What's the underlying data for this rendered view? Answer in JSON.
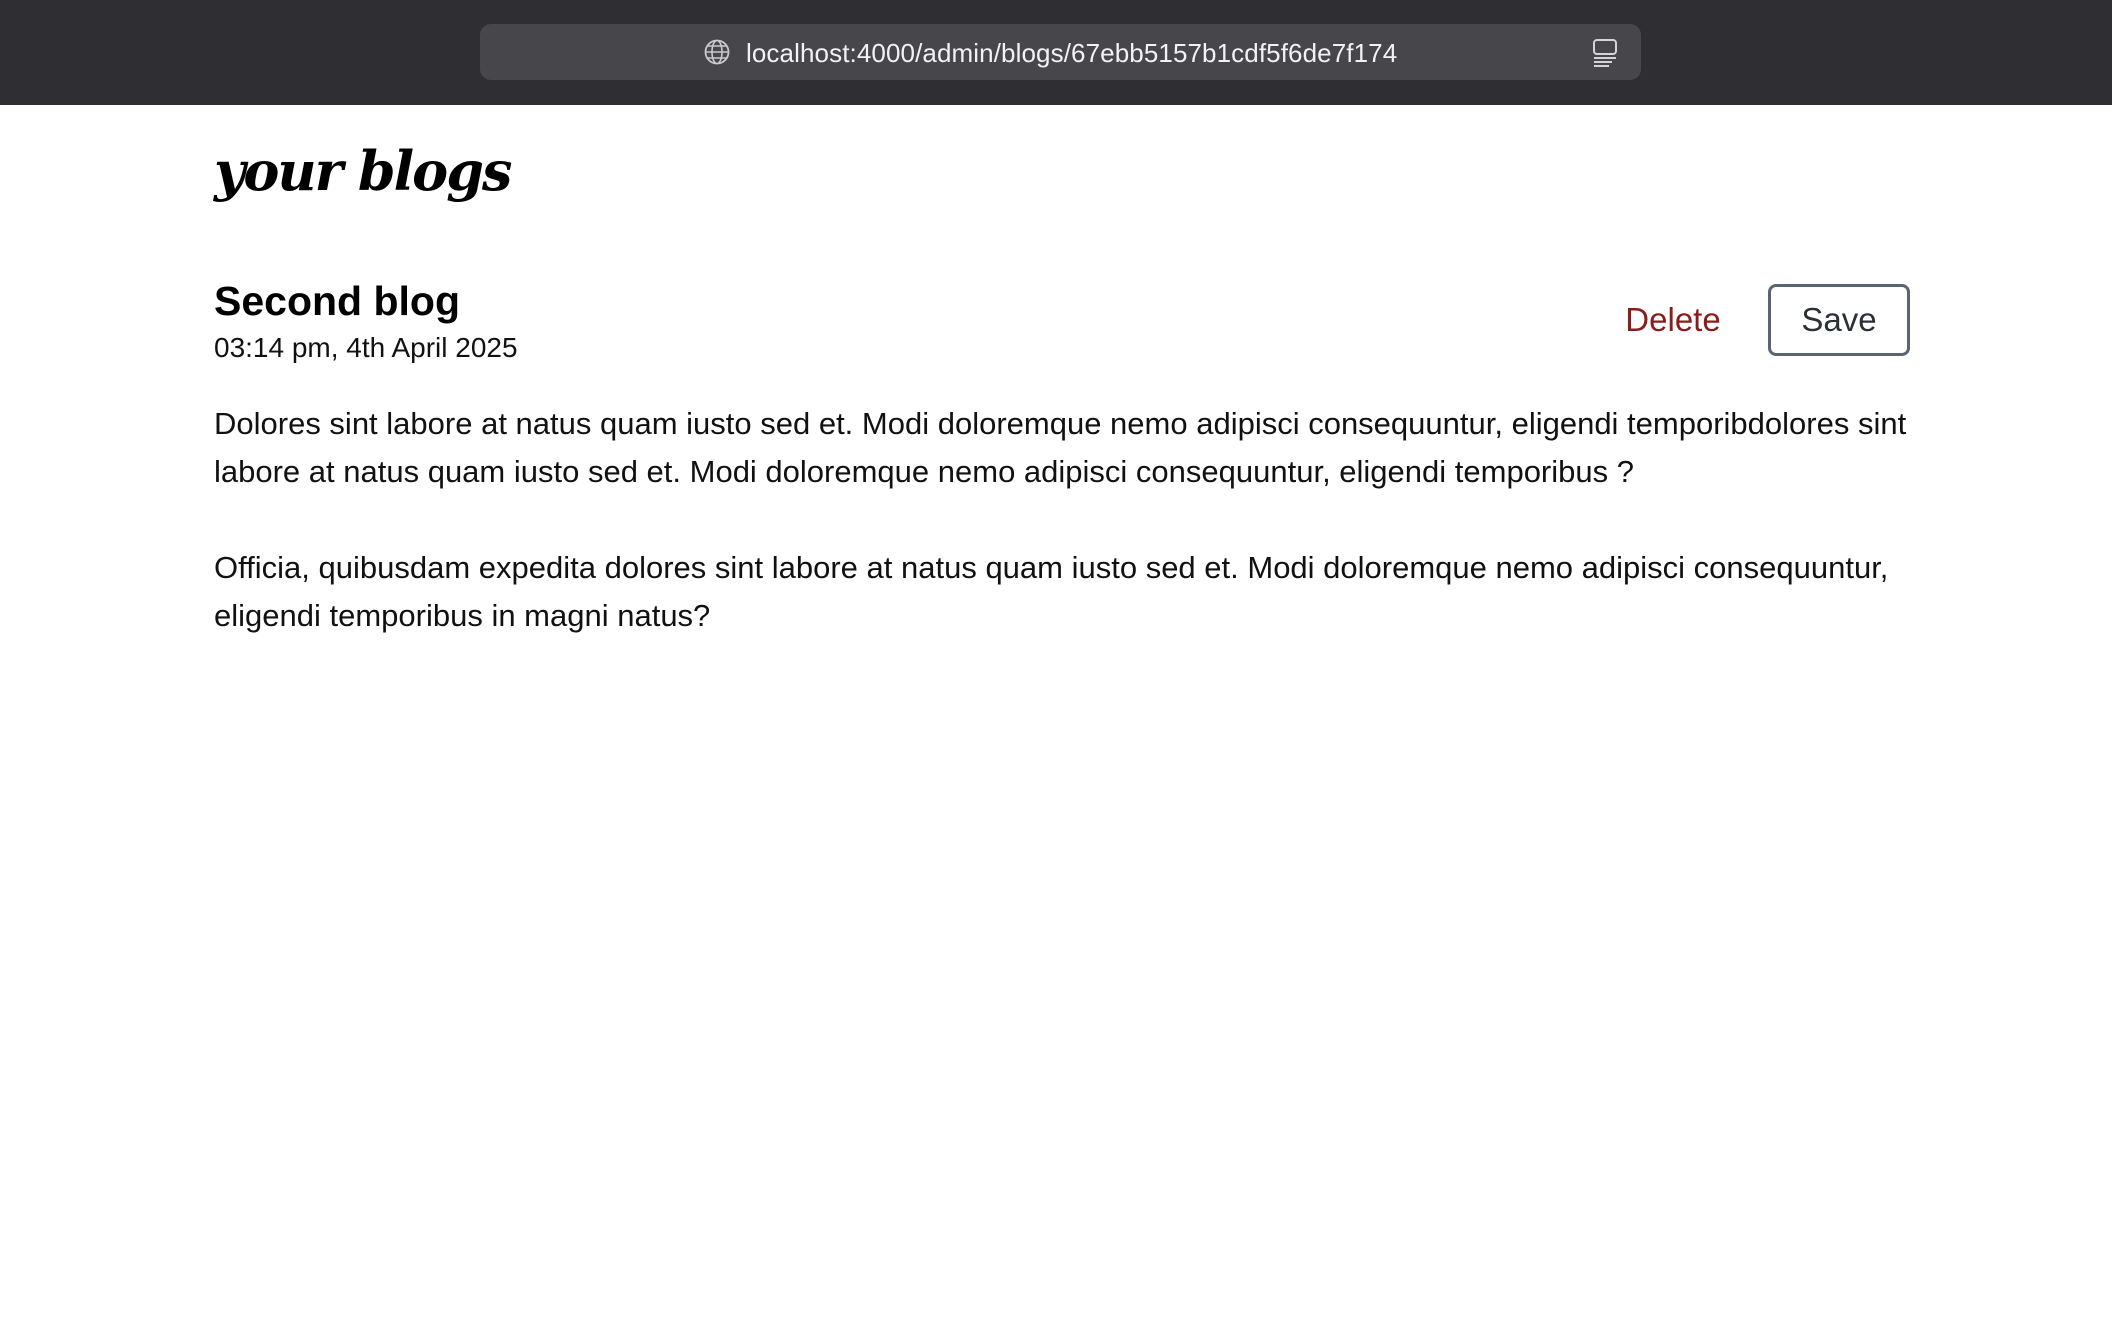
{
  "browser": {
    "url": "localhost:4000/admin/blogs/67ebb5157b1cdf5f6de7f174",
    "url_icon": "globe-icon",
    "reader_icon": "reader-icon"
  },
  "page": {
    "title": "your blogs"
  },
  "blog": {
    "title": "Second blog",
    "date": "03:14 pm, 4th April 2025",
    "paragraphs": [
      "Dolores sint labore at natus quam iusto sed et. Modi doloremque nemo adipisci consequuntur, eligendi temporibdolores sint labore at natus quam iusto sed et. Modi doloremque nemo adipisci consequuntur, eligendi temporibus ?",
      "Officia, quibusdam expedita dolores sint labore at natus quam iusto sed et. Modi doloremque nemo adipisci consequuntur, eligendi temporibus in magni natus?"
    ]
  },
  "actions": {
    "delete_label": "Delete",
    "save_label": "Save"
  },
  "colors": {
    "browser_bar": "#2f2f33",
    "url_field": "#46464b",
    "delete": "#8a1c1c",
    "save_border": "#5b6472"
  }
}
